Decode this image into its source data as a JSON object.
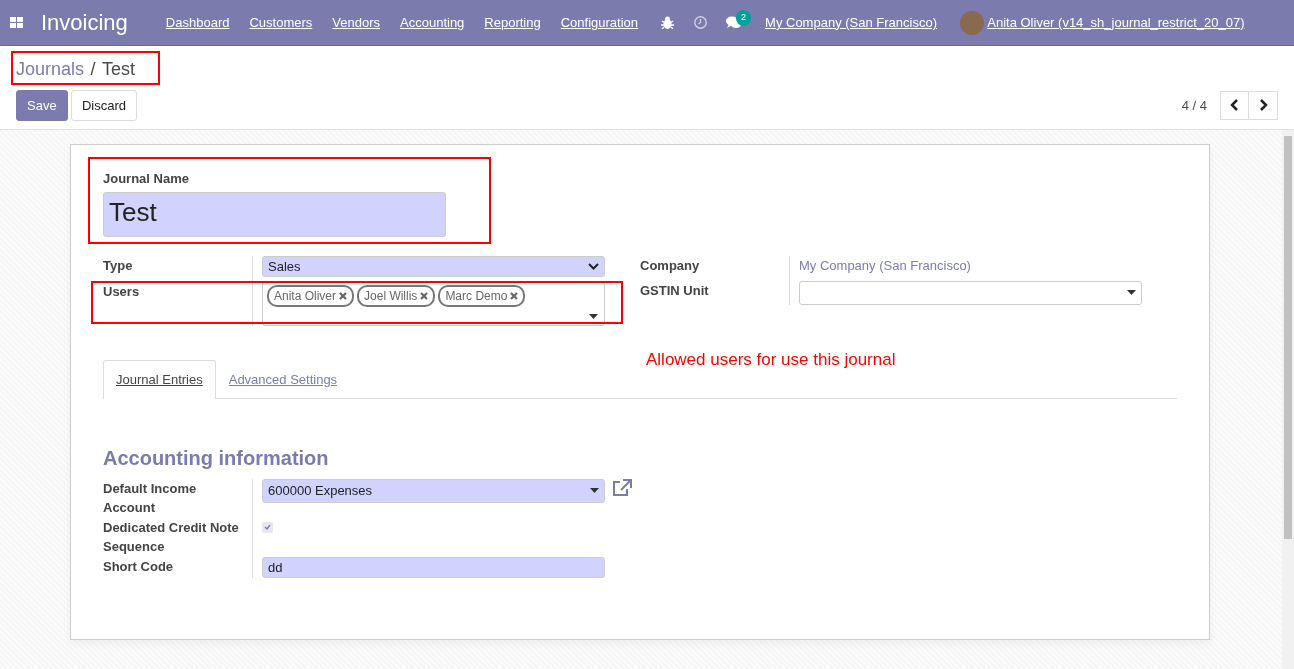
{
  "navbar": {
    "app_title": "Invoicing",
    "menu": [
      "Dashboard",
      "Customers",
      "Vendors",
      "Accounting",
      "Reporting",
      "Configuration"
    ],
    "chat_badge": "2",
    "company": "My Company (San Francisco)",
    "user": "Anita Oliver (v14_sh_journal_restrict_20_07)"
  },
  "breadcrumb": [
    {
      "label": "Journals",
      "kind": "link"
    },
    {
      "label": "Test",
      "kind": "current"
    }
  ],
  "breadcrumb_separator": "/",
  "buttons": [
    {
      "label": "Save",
      "kind": "primary"
    },
    {
      "label": "Discard",
      "kind": "secondary"
    }
  ],
  "pager": "4 / 4",
  "form": {
    "name_label": "Journal Name",
    "name_value": "Test",
    "left_fields": [
      {
        "label": "Type",
        "kind": "select",
        "value": "Sales"
      },
      {
        "label": "Users",
        "kind": "tags",
        "tags": [
          "Anita Oliver",
          "Joel Willis",
          "Marc Demo"
        ]
      }
    ],
    "right_fields": [
      {
        "label": "Company",
        "kind": "link",
        "value": "My Company (San Francisco)"
      },
      {
        "label": "GSTIN Unit",
        "kind": "many2one"
      }
    ],
    "tabs": [
      {
        "label": "Journal Entries",
        "selected": true
      },
      {
        "label": "Advanced Settings",
        "selected": false
      }
    ],
    "section_title": "Accounting information",
    "fields": [
      {
        "label": "Default Income Account",
        "kind": "many2one",
        "value": "600000 Expenses"
      },
      {
        "label": "Dedicated Credit Note Sequence",
        "kind": "checkbox",
        "checked": true
      },
      {
        "label": "Short Code",
        "kind": "input",
        "value": "dd"
      }
    ]
  },
  "annotation": "Allowed users for use this journal"
}
